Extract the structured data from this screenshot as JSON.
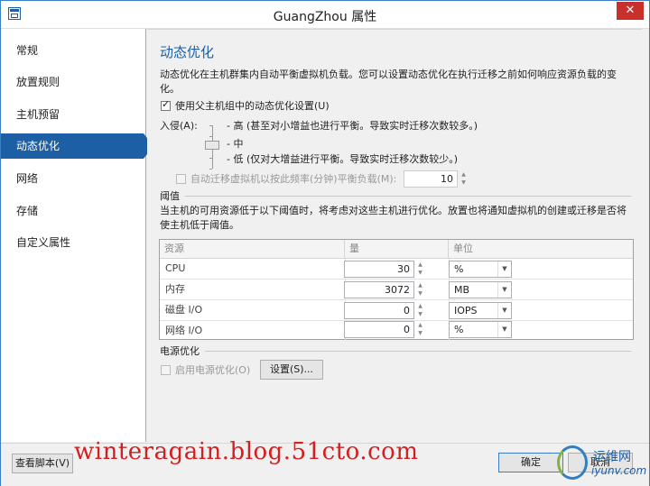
{
  "window": {
    "title": "GuangZhou 属性",
    "close_glyph": "✕"
  },
  "sidebar": {
    "items": [
      {
        "label": "常规"
      },
      {
        "label": "放置规则"
      },
      {
        "label": "主机预留"
      },
      {
        "label": "动态优化",
        "active": true
      },
      {
        "label": "网络"
      },
      {
        "label": "存储"
      },
      {
        "label": "自定义属性"
      }
    ]
  },
  "main": {
    "title": "动态优化",
    "description": "动态优化在主机群集内自动平衡虚拟机负载。您可以设置动态优化在执行迁移之前如何响应资源负载的变化。",
    "inherit_checkbox": {
      "label": "使用父主机组中的动态优化设置(U)",
      "checked": true
    },
    "aggressiveness": {
      "label": "入侵(A):",
      "high": "- 高 (甚至对小增益也进行平衡。导致实时迁移次数较多。)",
      "medium": "- 中",
      "low": "- 低 (仅对大增益进行平衡。导致实时迁移次数较少。)",
      "level": "中"
    },
    "auto_migrate": {
      "label": "自动迁移虚拟机以按此频率(分钟)平衡负载(M):",
      "checked": false,
      "value": "10"
    },
    "thresholds": {
      "title": "阈值",
      "description": "当主机的可用资源低于以下阈值时，将考虑对这些主机进行优化。放置也将通知虚拟机的创建或迁移是否将使主机低于阈值。",
      "columns": [
        "资源",
        "量",
        "单位"
      ],
      "rows": [
        {
          "resource": "CPU",
          "amount": "30",
          "unit": "%"
        },
        {
          "resource": "内存",
          "amount": "3072",
          "unit": "MB"
        },
        {
          "resource": "磁盘 I/O",
          "amount": "0",
          "unit": "IOPS"
        },
        {
          "resource": "网络 I/O",
          "amount": "0",
          "unit": "%"
        }
      ]
    },
    "power": {
      "title": "电源优化",
      "enable_label": "启用电源优化(O)",
      "enabled": false,
      "settings_button": "设置(S)..."
    }
  },
  "footer": {
    "view_script_button": "查看脚本(V)",
    "ok_button": "确定",
    "cancel_button": "取消"
  },
  "overlay": {
    "watermark": "winteragain.blog.51cto.com",
    "logo_line1": "运维网",
    "logo_line2": "iyunv.com"
  }
}
